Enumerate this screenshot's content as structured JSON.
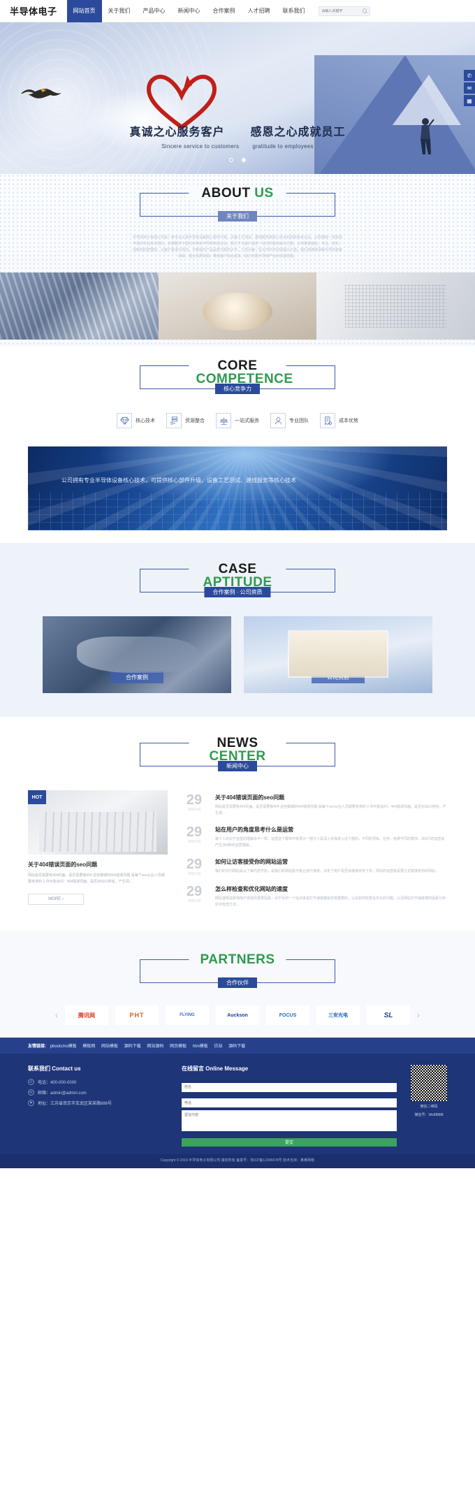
{
  "site": {
    "logo": "半导体电子"
  },
  "nav": {
    "items": [
      {
        "label": "网站首页",
        "active": true
      },
      {
        "label": "关于我们",
        "active": false
      },
      {
        "label": "产品中心",
        "active": false
      },
      {
        "label": "新闻中心",
        "active": false
      },
      {
        "label": "合作案例",
        "active": false
      },
      {
        "label": "人才招聘",
        "active": false
      },
      {
        "label": "联系我们",
        "active": false
      }
    ],
    "search_placeholder": "请输入关键字",
    "search_value": ""
  },
  "hero": {
    "title_left": "真诚之心服务客户",
    "title_right": "感恩之心成就员工",
    "sub_left": "Sincere service to customers",
    "sub_right": "gratitude to employees",
    "slide_count": 2,
    "active_slide": 2,
    "side_tools": [
      {
        "icon": "phone-icon",
        "glyph": "✆"
      },
      {
        "icon": "bell-icon",
        "glyph": "✉"
      },
      {
        "icon": "qrcode-icon",
        "glyph": "▦"
      }
    ]
  },
  "about": {
    "en_black": "ABOUT",
    "en_green": "US",
    "badge": "关于我们",
    "body": "半导体电子有限公司是一家专业从事半导体设备核心部件升级、设备工艺测试、建线服务等核心技术的高新技术企业。公司拥有一支经验丰富的专业技术团队，长期服务于国内外知名半导体制造企业，致力于为客户提供一站式的整体解决方案。公司秉承诚信、专业、务实、创新的经营理念，以客户需求为导向，不断提升产品品质与服务水平，力求为每一位合作伙伴创造最大价值。我们将继续深耕半导体装备领域，整合优质资源，降低客户综合成本，助力中国半导体产业的快速发展。",
    "photos": [
      {
        "name": "factory-machine-photo"
      },
      {
        "name": "coffee-cup-photo"
      },
      {
        "name": "chip-wafer-photo"
      }
    ]
  },
  "core": {
    "en_black": "CORE",
    "en_green": "COMPETENCE",
    "badge": "核心竞争力",
    "features": [
      {
        "label": "核心技术",
        "icon": "diamond-icon",
        "glyph": "◇"
      },
      {
        "label": "资源整合",
        "icon": "server-hand-icon",
        "glyph": "≡"
      },
      {
        "label": "一站式服务",
        "icon": "scales-icon",
        "glyph": "⚖"
      },
      {
        "label": "专业团队",
        "icon": "people-icon",
        "glyph": "☻"
      },
      {
        "label": "成本优势",
        "icon": "receipt-icon",
        "glyph": "▤"
      }
    ],
    "banner_text": "公司拥有专业半导体设备核心技术，可提供核心部件升级、设备工艺测试、建线服务等核心技术"
  },
  "cases": {
    "en_black": "CASE",
    "en_green": "APTITUDE",
    "badge": "合作案例 · 公司资质",
    "cards": [
      {
        "label": "合作案例",
        "image": "handshake-photo"
      },
      {
        "label": "公司资质",
        "image": "certificate-photo"
      }
    ]
  },
  "news": {
    "en_black": "NEWS",
    "en_green": "CENTER",
    "badge": "新闻中心",
    "hot_tag": "HOT",
    "featured": {
      "title": "关于404错误页面的seo问题",
      "desc": "网站是否需要有404的面，是否需要做404 这些都或的404错误问题 是每个seo从业人员都要考虑的-1 你可能会问：404错误页面，是否对SEO排名，产生调...",
      "more": "MORE ›"
    },
    "items": [
      {
        "day": "29",
        "ym": "2019-10",
        "title": "关于404错误页面的seo问题",
        "desc": "网站是否需要有404页面，是否需要做404 这些都或的404错误问题 是每个seo从业人员都要考虑的-1 你可能会问：404错误页面，是否对SEO排名，产生调..."
      },
      {
        "day": "29",
        "ym": "2019-10",
        "title": "站在用户的角度思考什么是运营",
        "desc": "每个人的对于运营的理解会不一样，运营这个群体中有很大一部分人是深入实操进入这个圈的，不同的项目、业务、免费不同的模块，360行的运营会产生360种的运营理解..."
      },
      {
        "day": "29",
        "ym": "2019-10",
        "title": "如何让访客接受你的网站运营",
        "desc": "我们的访问网站是从了解内容开始，是我们的网站能不能让用户接受，决定了用户是否会继续浏览下去，网站的运营就是要让访客接受你的网站..."
      },
      {
        "day": "29",
        "ym": "2019-10",
        "title": "怎么样检查和优化网站的速度",
        "desc": "网站速度是影响用户体验的重要因素，对于任何一个站点来说打开速度都是非常重要的，以及如何检查及优化的问题，以及网站打开速度慢的因素分析-针对检查方法..."
      }
    ]
  },
  "partners": {
    "en_black": "PARTNERS",
    "badge": "合作伙伴",
    "logos": [
      {
        "name": "tencent-logo",
        "text": "腾讯网"
      },
      {
        "name": "pht-logo",
        "text": "PHT"
      },
      {
        "name": "flying-logo",
        "text": "FLYING"
      },
      {
        "name": "auckson-logo",
        "text": "Auckson"
      },
      {
        "name": "focus-logo",
        "text": "FOCUS"
      },
      {
        "name": "sanan-logo",
        "text": "三安光电"
      },
      {
        "name": "sl-logo",
        "text": "SL"
      }
    ],
    "prev": "‹",
    "next": "›"
  },
  "friend_links": {
    "title": "友情链接:",
    "items": [
      "pbootcms模板",
      "模板网",
      "网站模板",
      "源码下载",
      "网站源码",
      "网页模板",
      "htm模板",
      "仿站",
      "源码下载"
    ]
  },
  "footer": {
    "contact": {
      "title": "联系我们 Contact us",
      "lines": [
        {
          "icon": "phone-icon",
          "glyph": "✆",
          "text": "电话：400-000-0000"
        },
        {
          "icon": "mail-icon",
          "glyph": "✉",
          "text": "邮箱：admin@admin.com"
        },
        {
          "icon": "location-icon",
          "glyph": "⚑",
          "text": "地址：江苏省南京市玄武区某某路888号"
        }
      ]
    },
    "message": {
      "title": "在线留言 Online Message",
      "name_placeholder": "姓名",
      "phone_placeholder": "电话",
      "content_placeholder": "留言内容",
      "submit": "提交"
    },
    "qr": {
      "caption_line1": "微信二维码",
      "caption_line2": "微信号：Wx88888"
    },
    "copyright": "Copyright © 2019 半导体电子有限公司 版权所有  备案号：苏ICP备12345678号  技术支持：某某网络"
  }
}
